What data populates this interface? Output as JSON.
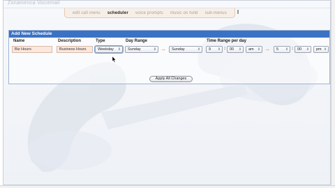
{
  "app": {
    "title": "Zonamerica Voicemail"
  },
  "tabs": [
    {
      "label": "edit call menu"
    },
    {
      "label": "scheduler"
    },
    {
      "label": "voice prompts"
    },
    {
      "label": "music on hold"
    },
    {
      "label": "sub-menus"
    }
  ],
  "panel": {
    "title": "Add New Schedule",
    "columns": {
      "name": "Name",
      "description": "Description",
      "type": "Type",
      "day_range": "Day Range",
      "time_range": "Time Range per day"
    },
    "row": {
      "name": "Biz Hours",
      "description": "Business Hours",
      "type": "Weekday",
      "day_from": "Sunday",
      "day_to": "Sunday",
      "start_hour": "9",
      "start_minute": "00",
      "start_ampm": "am",
      "end_hour": "5",
      "end_minute": "00",
      "end_ampm": "pm"
    },
    "colon": ":",
    "arrow_symbol": "→"
  },
  "actions": {
    "apply_label": "Apply All Changes"
  },
  "colors": {
    "header_blue": "#3a72c4",
    "field_peach": "#fbe7dc",
    "arrow_orange": "#e07a2a",
    "tab_active": "#222222",
    "tab_inactive": "#b49a87"
  },
  "icons": {
    "select_chevron": "updown-chevron-icon",
    "cursor": "mouse-pointer-icon",
    "watermark": "telephone-handset-icon"
  }
}
